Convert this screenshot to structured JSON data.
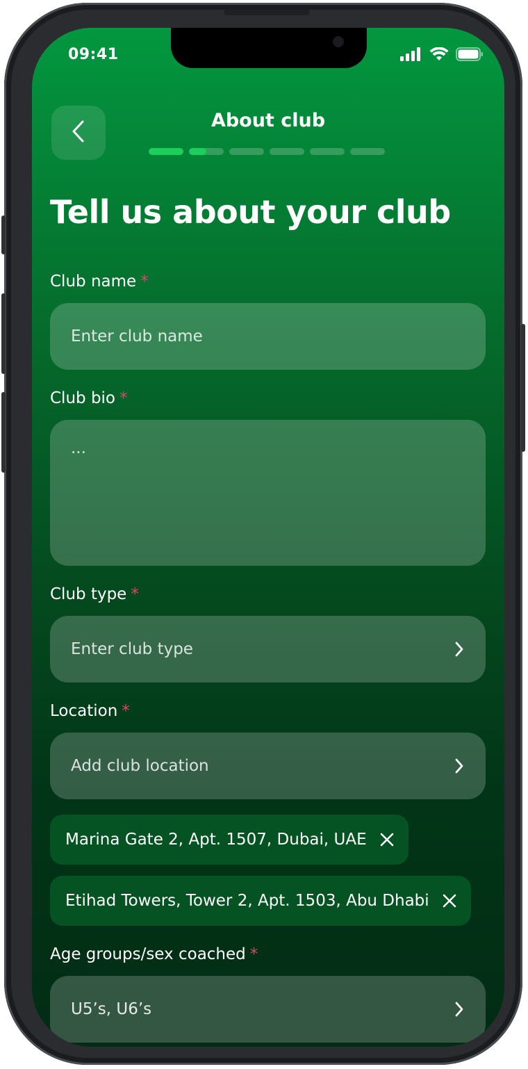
{
  "status_bar": {
    "time": "09:41"
  },
  "header": {
    "title": "About club",
    "progress_steps": [
      1,
      0.5,
      0,
      0,
      0,
      0
    ]
  },
  "page": {
    "title": "Tell us about your club"
  },
  "form": {
    "required_mark": "*",
    "club_name": {
      "label": "Club name",
      "placeholder": "Enter club name"
    },
    "club_bio": {
      "label": "Club bio",
      "placeholder": "..."
    },
    "club_type": {
      "label": "Club type",
      "placeholder": "Enter club type"
    },
    "location": {
      "label": "Location",
      "placeholder": "Add club location",
      "chips": [
        "Marina Gate 2, Apt. 1507, Dubai, UAE",
        "Etihad Towers, Tower 2, Apt. 1503, Abu Dhabi"
      ]
    },
    "age_groups": {
      "label": "Age groups/sex coached",
      "value": "U5’s, U6’s"
    }
  },
  "icons": {
    "back": "chevron-left-icon",
    "select": "chevron-right-icon",
    "remove": "close-icon",
    "signal": "cellular-signal-icon",
    "wifi": "wifi-icon",
    "battery": "battery-icon"
  },
  "colors": {
    "gradient_top": "#03973f",
    "gradient_bottom": "#022c14",
    "progress_active": "#1ccf5a",
    "required": "#e0446a"
  }
}
